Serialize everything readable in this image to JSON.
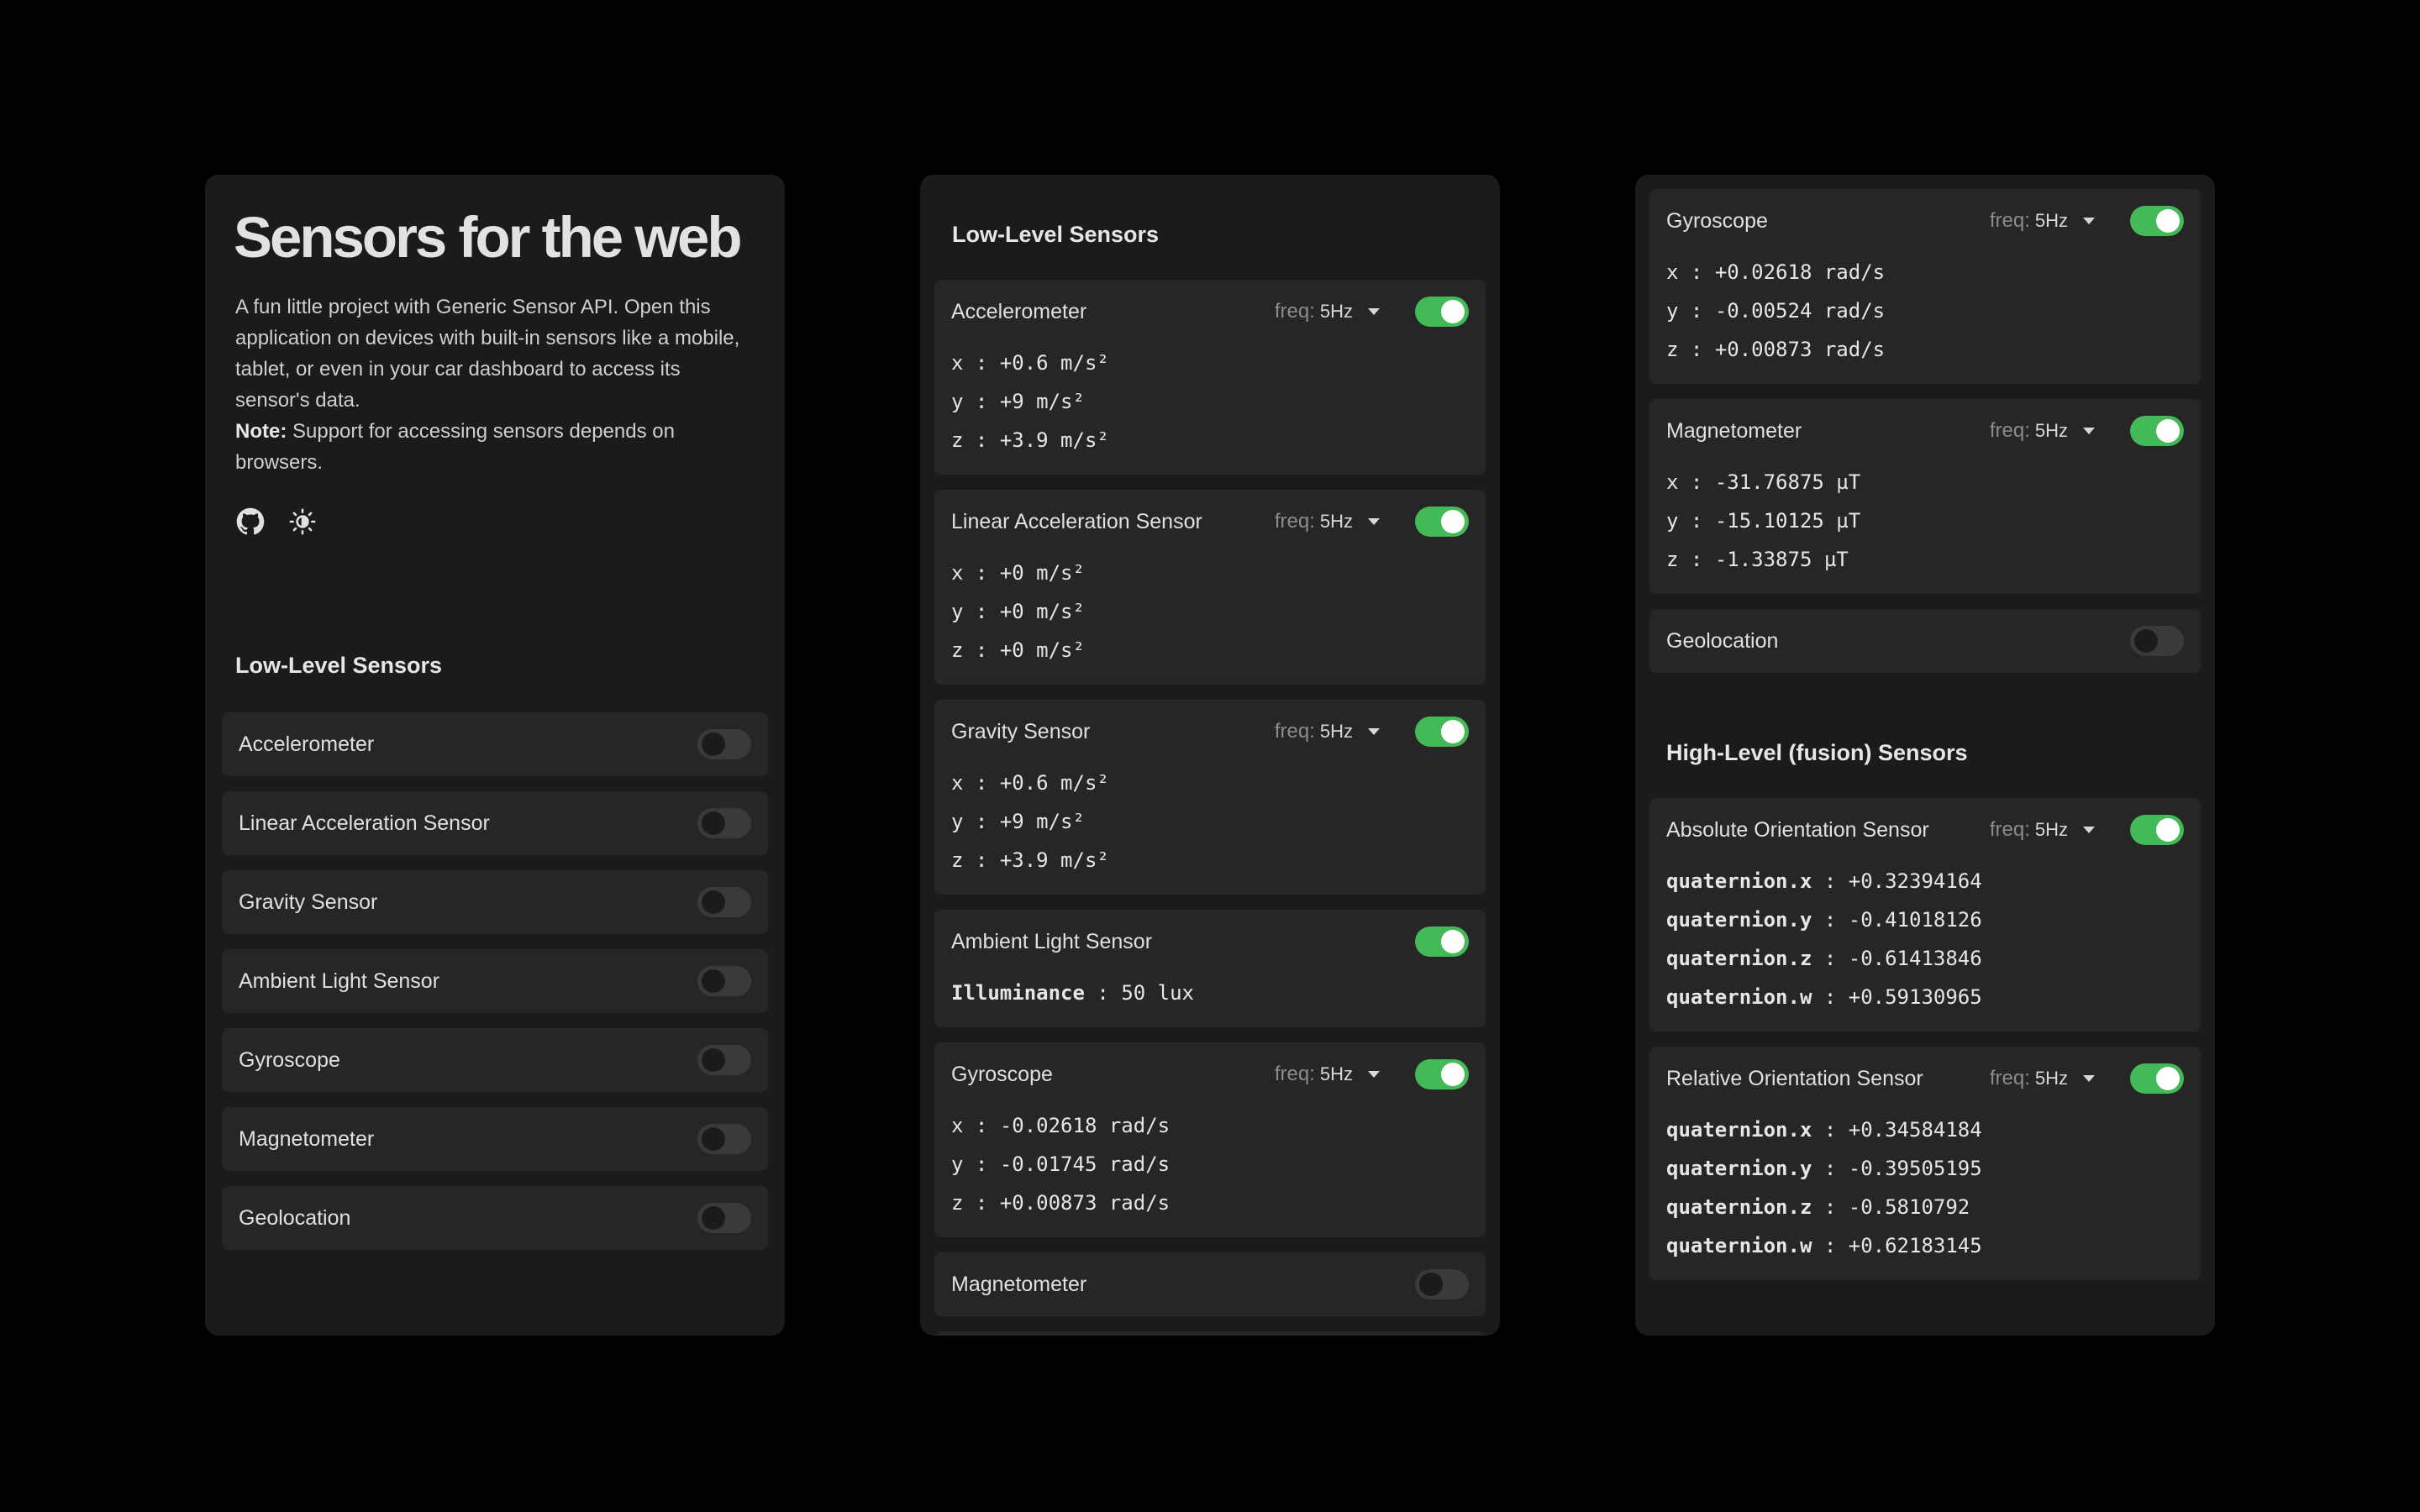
{
  "panel1": {
    "title": "Sensors for the web",
    "description": "A fun little project with Generic Sensor API. Open this application on devices with built-in sensors like a mobile, tablet, or even in your car dashboard to access its sensor's data.",
    "note_label": "Note:",
    "note_text": " Support for accessing sensors depends on browsers.",
    "icons": [
      "github-icon",
      "brightness-icon"
    ],
    "section_title": "Low-Level Sensors",
    "sensors": [
      {
        "label": "Accelerometer",
        "on": false
      },
      {
        "label": "Linear Acceleration Sensor",
        "on": false
      },
      {
        "label": "Gravity Sensor",
        "on": false
      },
      {
        "label": "Ambient Light Sensor",
        "on": false
      },
      {
        "label": "Gyroscope",
        "on": false
      },
      {
        "label": "Magnetometer",
        "on": false
      },
      {
        "label": "Geolocation",
        "on": false
      }
    ]
  },
  "panel2": {
    "section_title": "Low-Level Sensors",
    "freq_label": "freq:",
    "cards": [
      {
        "label": "Accelerometer",
        "freq": "5Hz",
        "on": true,
        "values": [
          {
            "k": "x",
            "v": "+0.6 m/s²"
          },
          {
            "k": "y",
            "v": "+9 m/s²"
          },
          {
            "k": "z",
            "v": "+3.9 m/s²"
          }
        ]
      },
      {
        "label": "Linear Acceleration Sensor",
        "freq": "5Hz",
        "on": true,
        "values": [
          {
            "k": "x",
            "v": "+0 m/s²"
          },
          {
            "k": "y",
            "v": "+0 m/s²"
          },
          {
            "k": "z",
            "v": "+0 m/s²"
          }
        ]
      },
      {
        "label": "Gravity Sensor",
        "freq": "5Hz",
        "on": true,
        "values": [
          {
            "k": "x",
            "v": "+0.6 m/s²"
          },
          {
            "k": "y",
            "v": "+9 m/s²"
          },
          {
            "k": "z",
            "v": "+3.9 m/s²"
          }
        ]
      },
      {
        "label": "Ambient Light Sensor",
        "on": true,
        "values": [
          {
            "k": "Illuminance",
            "v": "50 lux",
            "bold": true
          }
        ]
      },
      {
        "label": "Gyroscope",
        "freq": "5Hz",
        "on": true,
        "values": [
          {
            "k": "x",
            "v": "-0.02618 rad/s"
          },
          {
            "k": "y",
            "v": "-0.01745 rad/s"
          },
          {
            "k": "z",
            "v": "+0.00873 rad/s"
          }
        ]
      },
      {
        "label": "Magnetometer",
        "on": false,
        "values": []
      },
      {
        "label": "",
        "on": false,
        "values": []
      }
    ]
  },
  "panel3": {
    "freq_label": "freq:",
    "cards_top": [
      {
        "label": "Gyroscope",
        "freq": "5Hz",
        "on": true,
        "values": [
          {
            "k": "x",
            "v": "+0.02618 rad/s"
          },
          {
            "k": "y",
            "v": "-0.00524 rad/s"
          },
          {
            "k": "z",
            "v": "+0.00873 rad/s"
          }
        ]
      },
      {
        "label": "Magnetometer",
        "freq": "5Hz",
        "on": true,
        "values": [
          {
            "k": "x",
            "v": "-31.76875 µT"
          },
          {
            "k": "y",
            "v": "-15.10125 µT"
          },
          {
            "k": "z",
            "v": "-1.33875 µT"
          }
        ]
      },
      {
        "label": "Geolocation",
        "on": false,
        "values": []
      }
    ],
    "section_title": "High-Level (fusion) Sensors",
    "cards_bottom": [
      {
        "label": "Absolute Orientation Sensor",
        "freq": "5Hz",
        "on": true,
        "values": [
          {
            "k": "quaternion.x",
            "v": "+0.32394164",
            "bold": true
          },
          {
            "k": "quaternion.y",
            "v": "-0.41018126",
            "bold": true
          },
          {
            "k": "quaternion.z",
            "v": "-0.61413846",
            "bold": true
          },
          {
            "k": "quaternion.w",
            "v": "+0.59130965",
            "bold": true
          }
        ]
      },
      {
        "label": "Relative Orientation Sensor",
        "freq": "5Hz",
        "on": true,
        "values": [
          {
            "k": "quaternion.x",
            "v": "+0.34584184",
            "bold": true
          },
          {
            "k": "quaternion.y",
            "v": "-0.39505195",
            "bold": true
          },
          {
            "k": "quaternion.z",
            "v": "-0.5810792",
            "bold": true
          },
          {
            "k": "quaternion.w",
            "v": "+0.62183145",
            "bold": true
          }
        ]
      }
    ]
  },
  "colors": {
    "accent": "#43b957",
    "background": "#000000",
    "panel": "#1b1b1b",
    "card": "#262626"
  }
}
